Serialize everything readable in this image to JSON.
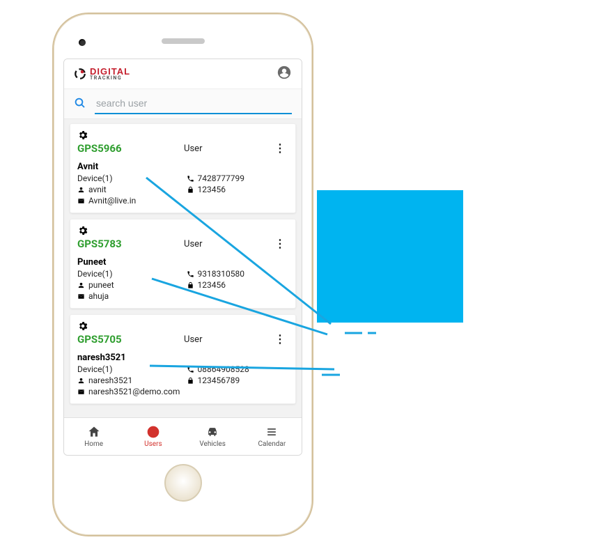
{
  "logo": {
    "primary": "DIGITAL",
    "secondary": "TRACKING"
  },
  "search": {
    "placeholder": "search user"
  },
  "users": [
    {
      "gps_id": "GPS5966",
      "role": "User",
      "name": "Avnit",
      "device": "Device(1)",
      "phone": "7428777799",
      "username": "avnit",
      "password": "123456",
      "email": "Avnit@live.in"
    },
    {
      "gps_id": "GPS5783",
      "role": "User",
      "name": "Puneet",
      "device": "Device(1)",
      "phone": "9318310580",
      "username": "puneet",
      "password": "123456",
      "email": "ahuja"
    },
    {
      "gps_id": "GPS5705",
      "role": "User",
      "name": "naresh3521",
      "device": "Device(1)",
      "phone": "08864908528",
      "username": "naresh3521",
      "password": "123456789",
      "email": "naresh3521@demo.com"
    }
  ],
  "nav": {
    "home": "Home",
    "users": "Users",
    "vehicles": "Vehicles",
    "calendar": "Calendar"
  }
}
